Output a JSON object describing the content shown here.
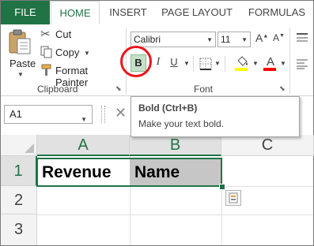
{
  "tabs": {
    "file": "FILE",
    "home": "HOME",
    "insert": "INSERT",
    "page_layout": "PAGE LAYOUT",
    "formulas": "FORMULAS"
  },
  "clipboard": {
    "paste": "Paste",
    "cut": "Cut",
    "copy": "Copy",
    "format_painter": "Format Painter",
    "group_label": "Clipboard"
  },
  "font": {
    "name": "Calibri",
    "size": "11",
    "bold": "B",
    "italic": "I",
    "underline": "U",
    "font_color_letter": "A",
    "group_label": "Font",
    "font_color": "#ff0000",
    "highlight_color": "#ffff00"
  },
  "name_box": "A1",
  "tooltip": {
    "title": "Bold (Ctrl+B)",
    "description": "Make your text bold."
  },
  "grid": {
    "columns": [
      "A",
      "B",
      "C"
    ],
    "rows": [
      "1",
      "2",
      "3"
    ],
    "cells": {
      "A1": "Revenue",
      "B1": "Name"
    }
  },
  "colors": {
    "accent": "#217346",
    "highlight_circle": "#e8161b",
    "selection_fill": "#c6c6c6"
  }
}
